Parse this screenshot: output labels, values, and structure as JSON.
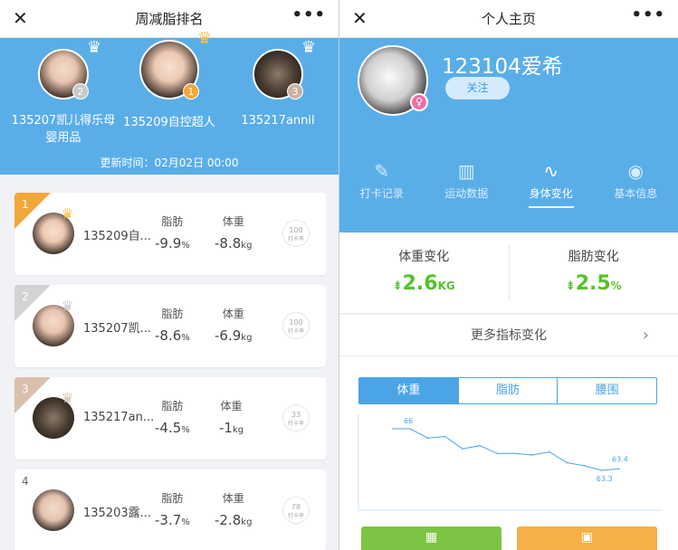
{
  "left": {
    "title": "周减脂排名",
    "podium": [
      {
        "rank": "2",
        "name": "135207凯儿得乐母婴用品"
      },
      {
        "rank": "1",
        "name": "135209自控超人"
      },
      {
        "rank": "3",
        "name": "135217annil"
      }
    ],
    "update_time": "更新时间：02月02日 00:00",
    "cards": [
      {
        "rank": "1",
        "name": "135209自...",
        "fat_label": "脂肪",
        "fat": "-9.9",
        "fat_unit": "%",
        "weight_label": "体重",
        "weight": "-8.8",
        "weight_unit": "kg",
        "rate": "100",
        "rate_label": "打卡率"
      },
      {
        "rank": "2",
        "name": "135207凯...",
        "fat_label": "脂肪",
        "fat": "-8.6",
        "fat_unit": "%",
        "weight_label": "体重",
        "weight": "-6.9",
        "weight_unit": "kg",
        "rate": "100",
        "rate_label": "打卡率"
      },
      {
        "rank": "3",
        "name": "135217an...",
        "fat_label": "脂肪",
        "fat": "-4.5",
        "fat_unit": "%",
        "weight_label": "体重",
        "weight": "-1",
        "weight_unit": "kg",
        "rate": "33",
        "rate_label": "打卡率"
      },
      {
        "rank": "4",
        "name": "135203露...",
        "fat_label": "脂肪",
        "fat": "-3.7",
        "fat_unit": "%",
        "weight_label": "体重",
        "weight": "-2.8",
        "weight_unit": "kg",
        "rate": "78",
        "rate_label": "打卡率"
      }
    ]
  },
  "right": {
    "title": "个人主页",
    "username": "123104爱希",
    "follow_label": "关注",
    "tabs": [
      {
        "label": "打卡记录",
        "icon": "checkin-icon"
      },
      {
        "label": "运动数据",
        "icon": "bar-chart-icon"
      },
      {
        "label": "身体变化",
        "icon": "trend-icon"
      },
      {
        "label": "基本信息",
        "icon": "profile-icon"
      }
    ],
    "weight_change_label": "体重变化",
    "weight_change": "2.6",
    "weight_change_unit": "KG",
    "fat_change_label": "脂肪变化",
    "fat_change": "2.5",
    "fat_change_unit": "%",
    "more_metrics": "更多指标变化",
    "segments": [
      "体重",
      "脂肪",
      "腰围"
    ],
    "active_segment": "体重"
  },
  "colors": {
    "header_blue": "#5aaee8",
    "green": "#55c22c",
    "gold": "#f3a73b"
  },
  "chart_data": {
    "type": "line",
    "title": "",
    "series": [
      {
        "values": [
          66,
          66,
          65.4,
          65.5,
          64.7,
          64.9,
          64.4,
          64.4,
          64.3,
          64.5,
          63.8,
          63.6,
          63.3,
          63.4
        ]
      }
    ],
    "annotations": [
      "66",
      "63.4",
      "63.3"
    ],
    "grid": false
  }
}
